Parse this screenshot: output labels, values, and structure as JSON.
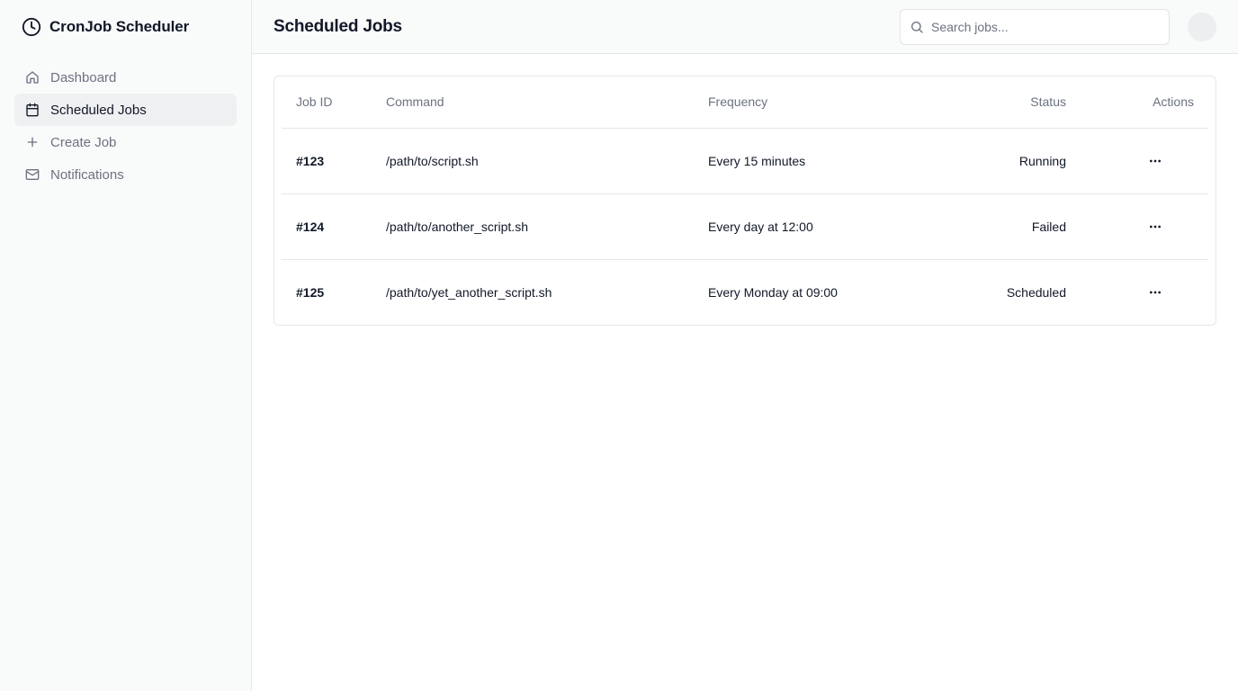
{
  "app": {
    "title": "CronJob Scheduler",
    "brand_icon": "clock-icon"
  },
  "sidebar": {
    "items": [
      {
        "label": "Dashboard",
        "icon": "home-icon",
        "active": false
      },
      {
        "label": "Scheduled Jobs",
        "icon": "calendar-icon",
        "active": true
      },
      {
        "label": "Create Job",
        "icon": "plus-icon",
        "active": false
      },
      {
        "label": "Notifications",
        "icon": "mail-icon",
        "active": false
      }
    ]
  },
  "header": {
    "title": "Scheduled Jobs",
    "search": {
      "placeholder": "Search jobs...",
      "value": ""
    }
  },
  "table": {
    "columns": {
      "id": "Job ID",
      "command": "Command",
      "frequency": "Frequency",
      "status": "Status",
      "actions": "Actions"
    },
    "rows": [
      {
        "id": "#123",
        "command": "/path/to/script.sh",
        "frequency": "Every 15 minutes",
        "status": "Running"
      },
      {
        "id": "#124",
        "command": "/path/to/another_script.sh",
        "frequency": "Every day at 12:00",
        "status": "Failed"
      },
      {
        "id": "#125",
        "command": "/path/to/yet_another_script.sh",
        "frequency": "Every Monday at 09:00",
        "status": "Scheduled"
      }
    ]
  },
  "colors": {
    "sidebar_bg": "#f9fafa",
    "active_item_bg": "#eff0f2",
    "muted_text": "#6b7280",
    "border": "#e5e7eb"
  }
}
